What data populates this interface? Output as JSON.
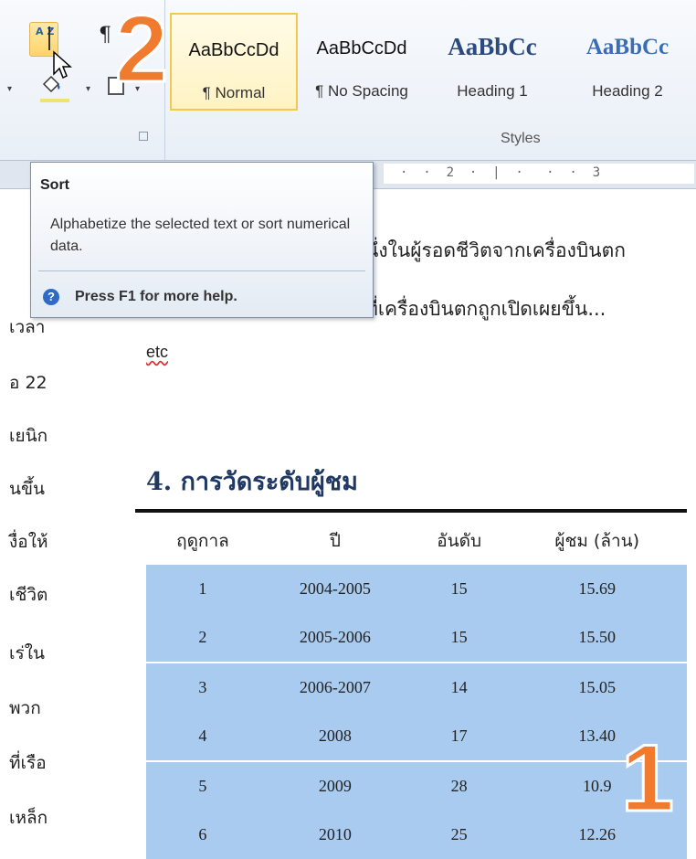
{
  "ribbon": {
    "pilcrow": "¶",
    "styles": [
      {
        "preview": "AaBbCcDd",
        "label": "¶ Normal"
      },
      {
        "preview": "AaBbCcDd",
        "label": "¶ No Spacing"
      },
      {
        "preview": "AaBbCc",
        "label": "Heading 1"
      },
      {
        "preview": "AaBbCc",
        "label": "Heading 2"
      }
    ],
    "group_label": "Styles",
    "sort_glyph": "A Z"
  },
  "ruler": {
    "text": "·  ·  2  ·  |  ·   ·  ·  3"
  },
  "tooltip": {
    "title": "Sort",
    "body": "Alphabetize the selected text or sort numerical data.",
    "help": "Press F1 for more help.",
    "help_icon": "?"
  },
  "document": {
    "line1": "นึ่งในผู้รอดชีวิตจากเครื่องบินตก",
    "line2": "ที่เครื่องบินตกถูกเปิดเผยขึ้น...",
    "etc": "etc",
    "left_fragments": [
      "เวลา",
      "อ 22",
      "เยนิก",
      "นขึ้น",
      "งื่อให้",
      "เชีวิต",
      "เร่ใน",
      "พวก",
      "ที่เรือ",
      "เหล็ก"
    ],
    "heading": "4. การวัดระดับผู้ชม"
  },
  "table": {
    "headers": [
      "ฤดูกาล",
      "ปี",
      "อันดับ",
      "ผู้ชม (ล้าน)"
    ],
    "rows": [
      [
        "1",
        "2004-2005",
        "15",
        "15.69"
      ],
      [
        "2",
        "2005-2006",
        "15",
        "15.50"
      ],
      [
        "3",
        "2006-2007",
        "14",
        "15.05"
      ],
      [
        "4",
        "2008",
        "17",
        "13.40"
      ],
      [
        "5",
        "2009",
        "28",
        "10.9"
      ],
      [
        "6",
        "2010",
        "25",
        "12.26"
      ]
    ]
  },
  "callouts": {
    "one": "1",
    "two": "2"
  },
  "colors": {
    "callout": "#f07a2d",
    "table_fill": "#a9cbf0",
    "heading": "#1f3864"
  }
}
